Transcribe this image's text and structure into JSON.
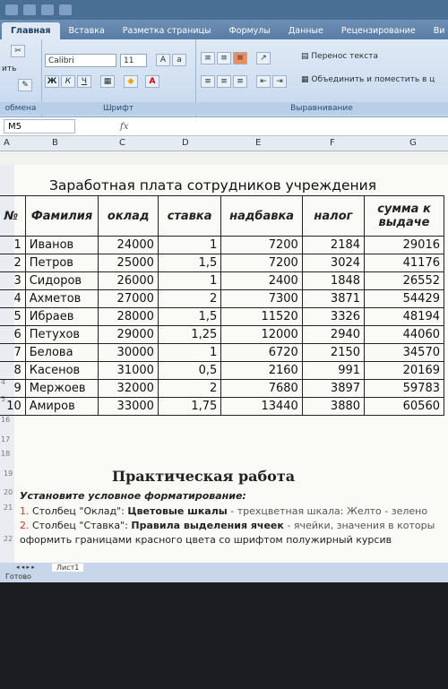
{
  "ribbon": {
    "tabs": [
      "Главная",
      "Вставка",
      "Разметка страницы",
      "Формулы",
      "Данные",
      "Рецензирование",
      "Ви"
    ],
    "paste_label": "ить",
    "font_name": "Calibri",
    "font_size": "11",
    "bold": "Ж",
    "italic": "К",
    "underline": "Ч",
    "wrap_text": "Перенос текста",
    "merge_center": "Объединить и поместить в ц",
    "groups": {
      "clipboard": "обмена",
      "font": "Шрифт",
      "alignment": "Выравнивание"
    }
  },
  "formula_bar": {
    "cell": "M5",
    "fx": "fx",
    "value": ""
  },
  "columns": [
    "A",
    "B",
    "C",
    "D",
    "E",
    "F",
    "G"
  ],
  "sheet": {
    "title": "Заработная плата сотрудников учреждения",
    "headers": [
      "№",
      "Фамилия",
      "оклад",
      "ставка",
      "надбавка",
      "налог",
      "сумма к выдаче"
    ],
    "rows": [
      [
        "1",
        "Иванов",
        "24000",
        "1",
        "7200",
        "2184",
        "29016"
      ],
      [
        "2",
        "Петров",
        "25000",
        "1,5",
        "7200",
        "3024",
        "41176"
      ],
      [
        "3",
        "Сидоров",
        "26000",
        "1",
        "2400",
        "1848",
        "26552"
      ],
      [
        "4",
        "Ахметов",
        "27000",
        "2",
        "7300",
        "3871",
        "54429"
      ],
      [
        "5",
        "Ибраев",
        "28000",
        "1,5",
        "11520",
        "3326",
        "48194"
      ],
      [
        "6",
        "Петухов",
        "29000",
        "1,25",
        "12000",
        "2940",
        "44060"
      ],
      [
        "7",
        "Белова",
        "30000",
        "1",
        "6720",
        "2150",
        "34570"
      ],
      [
        "8",
        "Касенов",
        "31000",
        "0,5",
        "2160",
        "991",
        "20169"
      ],
      [
        "9",
        "Мержоев",
        "32000",
        "2",
        "7680",
        "3897",
        "59783"
      ],
      [
        "10",
        "Амиров",
        "33000",
        "1,75",
        "13440",
        "3880",
        "60560"
      ]
    ],
    "row_numbers": [
      "4",
      "5",
      "16",
      "17",
      "18",
      "19",
      "20",
      "21",
      "22"
    ],
    "practice_title": "Практическая работа",
    "task_intro": "Установите условное форматирование:",
    "task1": {
      "num": "1.",
      "a": "Столбец \"Оклад\": ",
      "b": "Цветовые шкалы",
      "c": " - трехцветная шкала: Желто - зелено"
    },
    "task2": {
      "num": "2.",
      "a": "Столбец \"Ставка\": ",
      "b": "Правила выделения ячеек",
      "c": " - ячейки, значения в которы"
    },
    "task3": "оформить границами красного цвета со шрифтом полужирный курсив"
  },
  "status": {
    "sheet_tab": "Лист1",
    "ready": "Готово"
  },
  "colors": {
    "ribbon": "#dfe9f5",
    "title_bar": "#4a6f95",
    "red_text": "#c0392b",
    "screen_bg": "#1c1d20"
  }
}
